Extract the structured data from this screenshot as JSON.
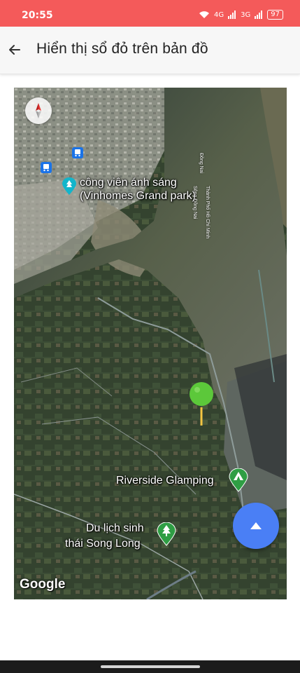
{
  "status_bar": {
    "time": "20:55",
    "battery": "97",
    "signal_1": "4G",
    "signal_2": "3G"
  },
  "app_bar": {
    "title": "Hiển thị sổ đỏ trên bản đồ"
  },
  "map": {
    "labels": {
      "park_line1": "công viên ánh sáng",
      "park_line2": "(Vinhomes Grand park)",
      "riverside": "Riverside Glamping",
      "song_long_line1": "Du lịch sinh",
      "song_long_line2": "thái Song Long",
      "river_dong_nai": "Sông Đồng Nai",
      "dong_nai": "Đồng Nai",
      "hcm": "Thành Phố Hồ Chí Minh"
    },
    "attribution": "Google",
    "marker_color": "#5cc83a"
  },
  "colors": {
    "status_bar": "#f45a5a",
    "fab": "#4a7ff5",
    "marker_green": "#2f9e44",
    "bus_blue": "#1a73e8"
  }
}
